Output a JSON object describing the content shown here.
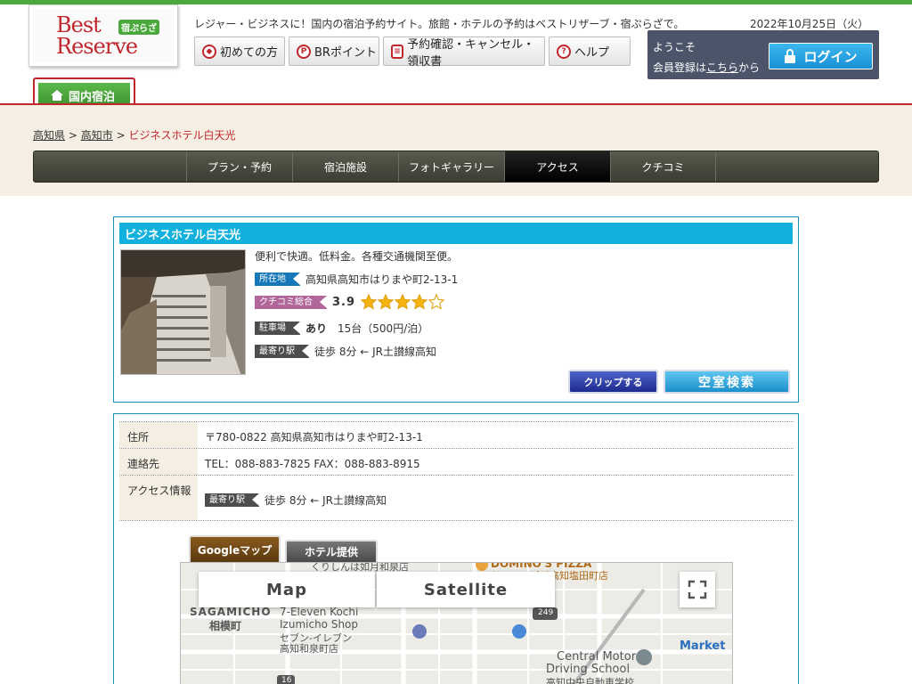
{
  "site": {
    "logo_best": "Best",
    "logo_reserve": "Reserve",
    "logo_badge": "宿ぷらざ",
    "tagline": "レジャー・ビジネスに！国内の宿泊予約サイト。旅館・ホテルの予約はベストリザーブ・宿ぷらざで。",
    "date": "2022年10月25日（火）"
  },
  "nav": {
    "first_time": "初めての方",
    "br_points": "BRポイント",
    "reservations": "予約確認・キャンセル・領収書",
    "help": "ヘルプ"
  },
  "account": {
    "welcome": "ようこそ",
    "register_prefix": "会員登録は",
    "register_link": "こちら",
    "register_suffix": "から",
    "login": "ログイン"
  },
  "category_tab": "国内宿泊",
  "breadcrumb": {
    "pref": "高知県",
    "city": "高知市",
    "sep": ">",
    "current": "ビジネスホテル白天光"
  },
  "subnav": [
    "プラン・予約",
    "宿泊施設",
    "フォトギャラリー",
    "アクセス",
    "クチコミ"
  ],
  "hotel": {
    "name": "ビジネスホテル白天光",
    "catchphrase": "便利で快適。低料金。各種交通機関至便。",
    "address_label": "所在地",
    "address": "高知県高知市はりまや町2-13-1",
    "review_label": "クチコミ総合",
    "review_score": "3.9",
    "review_stars": 4,
    "parking_label": "駐車場",
    "parking_avail": "あり",
    "parking_detail": "15台（500円/泊）",
    "station_label": "最寄り駅",
    "station": "徒歩 8分 ← JR土讃線高知",
    "clip_button": "クリップする",
    "search_button": "空室検索"
  },
  "access": {
    "address_label": "住所",
    "address": "〒780-0822 高知県高知市はりまや町2-13-1",
    "contact_label": "連絡先",
    "contact": "TEL：088-883-7825 FAX：088-883-8915",
    "access_label": "アクセス情報",
    "station_label": "最寄り駅",
    "station": "徒歩 8分 ← JR土讃線高知"
  },
  "map_tabs": {
    "google": "Googleマップ",
    "hotel": "ホテル提供"
  },
  "map": {
    "map_button": "Map",
    "satellite_button": "Satellite",
    "labels": {
      "sagamicho": "SAGAMICHO",
      "sagamicho_jp": "相模町",
      "seven_en1": "7-Eleven Kochi",
      "seven_en2": "Izumicho Shop",
      "seven_jp1": "セブン-イレブン",
      "seven_jp2": "高知和泉町店",
      "domino": "DOMINO'S PIZZA",
      "domino_jp": "ドミノ・ピザ高知塩田町店",
      "kurishin": "くりしんは如月和泉店",
      "school_en1": "Central Motor",
      "school_en2": "Driving School",
      "school_jp": "高知中央自動車学校",
      "market": "Market",
      "route_249": "249",
      "route_16": "16"
    }
  },
  "colors": {
    "brand_red": "#c0262c",
    "brand_green": "#4aa83c",
    "accent_cyan": "#12b0dc",
    "login_blue": "#1a8fd6"
  }
}
